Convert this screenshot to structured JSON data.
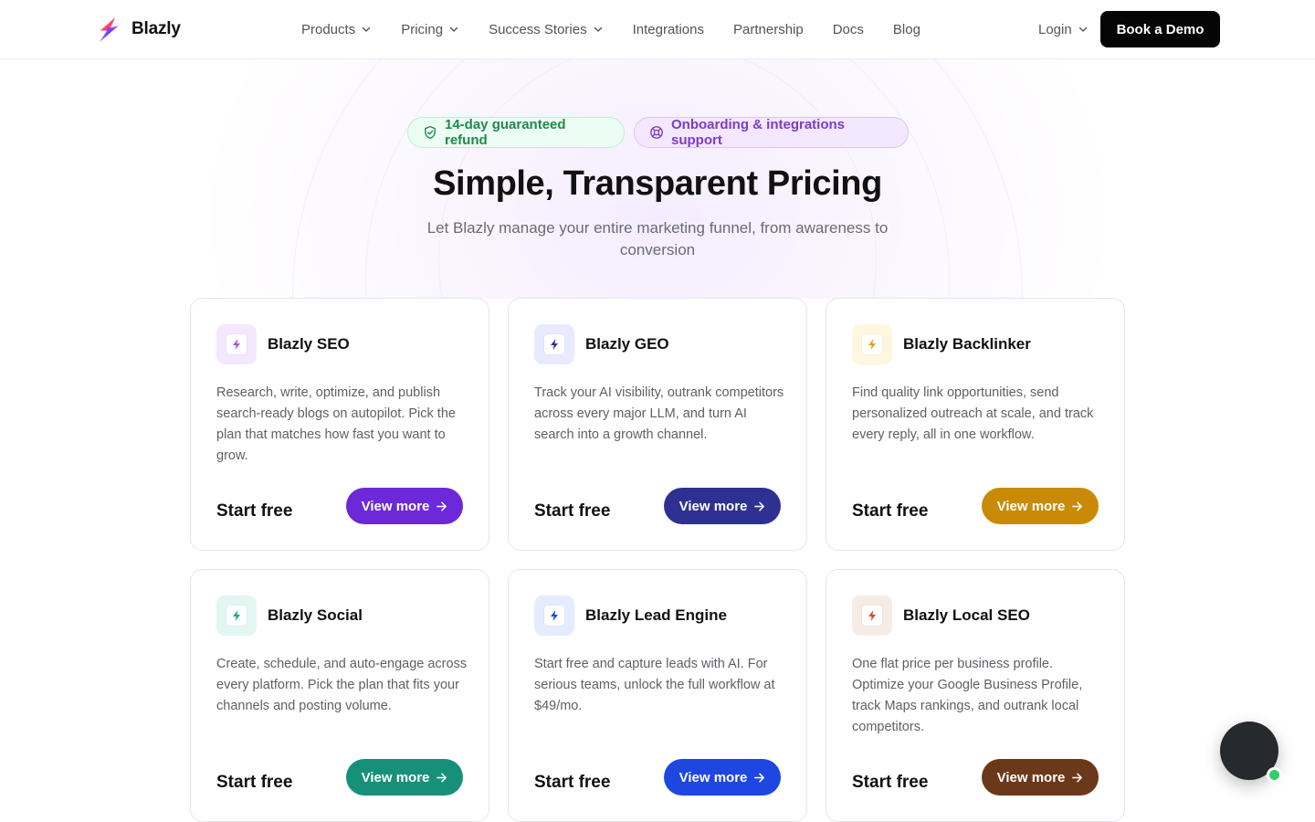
{
  "nav": {
    "brand": "Blazly",
    "links": [
      {
        "label": "Products",
        "dropdown": true
      },
      {
        "label": "Pricing",
        "dropdown": true
      },
      {
        "label": "Success Stories",
        "dropdown": true
      },
      {
        "label": "Integrations",
        "dropdown": false
      },
      {
        "label": "Partnership",
        "dropdown": false
      },
      {
        "label": "Docs",
        "dropdown": false
      },
      {
        "label": "Blog",
        "dropdown": false
      }
    ],
    "login": "Login",
    "cta": "Book a Demo"
  },
  "hero": {
    "badges": [
      {
        "label": "14-day guaranteed refund",
        "icon": "shield-check-icon"
      },
      {
        "label": "Onboarding & integrations support",
        "icon": "lifebuoy-icon"
      }
    ],
    "title": "Simple, Transparent Pricing",
    "subtitle": "Let Blazly manage your entire marketing funnel, from awareness to conversion"
  },
  "cards": [
    {
      "title": "Blazly SEO",
      "desc": "Research, write, optimize, and publish search-ready blogs on autopilot. Pick the plan that matches how fast you want to grow.",
      "price": "Start free",
      "button": "View more",
      "accent": "#6d28d9",
      "icon_bg": "#f3e8ff",
      "icon_color": "#b44fd6"
    },
    {
      "title": "Blazly GEO",
      "desc": "Track your AI visibility, outrank competitors across every major LLM, and turn AI search into a growth channel.",
      "price": "Start free",
      "button": "View more",
      "accent": "#2e3192",
      "icon_bg": "#e8eaff",
      "icon_color": "#2e3192"
    },
    {
      "title": "Blazly Backlinker",
      "desc": "Find quality link opportunities, send personalized outreach at scale, and track every reply, all in one workflow.",
      "price": "Start free",
      "button": "View more",
      "accent": "#c98a07",
      "icon_bg": "#fff6df",
      "icon_color": "#e2a210"
    },
    {
      "title": "Blazly Social",
      "desc": "Create, schedule, and auto-engage across every platform. Pick the plan that fits your channels and posting volume.",
      "price": "Start free",
      "button": "View more",
      "accent": "#17907a",
      "icon_bg": "#e2f7f2",
      "icon_color": "#17a58a"
    },
    {
      "title": "Blazly Lead Engine",
      "desc": "Start free and capture leads with AI. For serious teams, unlock the full workflow at $49/mo.",
      "price": "Start free",
      "button": "View more",
      "accent": "#1d47e0",
      "icon_bg": "#e6ecff",
      "icon_color": "#1d47e0"
    },
    {
      "title": "Blazly Local SEO",
      "desc": "One flat price per business profile. Optimize your Google Business Profile, track Maps rankings, and outrank local competitors.",
      "price": "Start free",
      "button": "View more",
      "accent": "#6b3819",
      "icon_bg": "#f6ece7",
      "icon_color": "#d14a34"
    }
  ],
  "chat": {
    "icon": "chat-widget-icon",
    "status_color": "#2fd06a"
  }
}
